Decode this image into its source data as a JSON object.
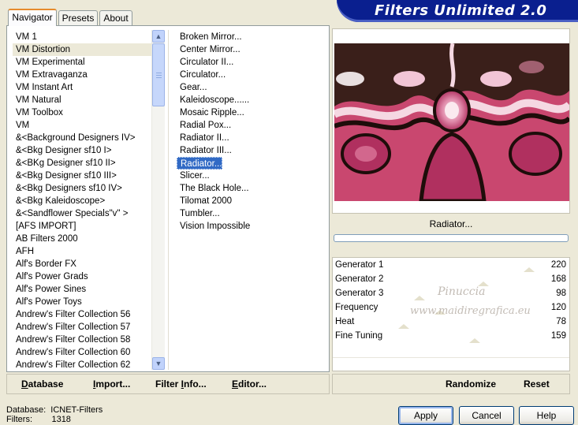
{
  "tabs": [
    {
      "label": "Navigator",
      "active": true
    },
    {
      "label": "Presets",
      "active": false
    },
    {
      "label": "About",
      "active": false
    }
  ],
  "categories": [
    "VM 1",
    "VM Distortion",
    "VM Experimental",
    "VM Extravaganza",
    "VM Instant Art",
    "VM Natural",
    "VM Toolbox",
    "VM",
    "&<Background Designers IV>",
    "&<Bkg Designer sf10 I>",
    "&<BKg Designer sf10 II>",
    "&<Bkg Designer sf10 III>",
    "&<Bkg Designers sf10 IV>",
    "&<Bkg Kaleidoscope>",
    "&<Sandflower Specials\"v\" >",
    "[AFS IMPORT]",
    "AB Filters 2000",
    "AFH",
    "Alf's Border FX",
    "Alf's Power Grads",
    "Alf's Power Sines",
    "Alf's Power Toys",
    "Andrew's Filter Collection 56",
    "Andrew's Filter Collection 57",
    "Andrew's Filter Collection 58",
    "Andrew's Filter Collection 60",
    "Andrew's Filter Collection 62"
  ],
  "selected_category": "VM Distortion",
  "filters": [
    "Broken Mirror...",
    "Center Mirror...",
    "Circulator II...",
    "Circulator...",
    "Gear...",
    "Kaleidoscope......",
    "Mosaic Ripple...",
    "Radial Pox...",
    "Radiator II...",
    "Radiator III...",
    "Radiator...",
    "Slicer...",
    "The Black Hole...",
    "Tilomat 2000",
    "Tumbler...",
    "Vision Impossible"
  ],
  "selected_filter": "Radiator...",
  "toolbar": {
    "database": {
      "pre": "",
      "ul": "D",
      "post": "atabase"
    },
    "import": {
      "pre": "",
      "ul": "I",
      "post": "mport..."
    },
    "filter_info": {
      "pre": "Filter ",
      "ul": "I",
      "post": "nfo..."
    },
    "editor": {
      "pre": "",
      "ul": "E",
      "post": "ditor..."
    }
  },
  "banner_title": "Filters Unlimited 2.0",
  "current_filter_label": "Radiator...",
  "parameters": [
    {
      "name": "Generator 1",
      "value": 220,
      "level": 0.86
    },
    {
      "name": "Generator 2",
      "value": 168,
      "level": 0.66
    },
    {
      "name": "Generator 3",
      "value": 98,
      "level": 0.38
    },
    {
      "name": "Frequency",
      "value": 120,
      "level": 0.47
    },
    {
      "name": "Heat",
      "value": 78,
      "level": 0.31
    },
    {
      "name": "Fine Tuning",
      "value": 159,
      "level": 0.62
    }
  ],
  "watermark": {
    "line1": "Pinuccia",
    "line2": "www.maidiregrafica.eu"
  },
  "right_toolbar": {
    "randomize": "Randomize",
    "reset": "Reset"
  },
  "status": {
    "database_label": "Database:",
    "database_value": "ICNET-Filters",
    "filters_label": "Filters:",
    "filters_value": "1318"
  },
  "buttons": {
    "apply": "Apply",
    "cancel": "Cancel",
    "help": "Help"
  },
  "colors": {
    "selection": "#316ac5",
    "banner": "#0a1f8f",
    "preview_magenta": "#b0305f",
    "preview_dark": "#3a1f1a"
  }
}
